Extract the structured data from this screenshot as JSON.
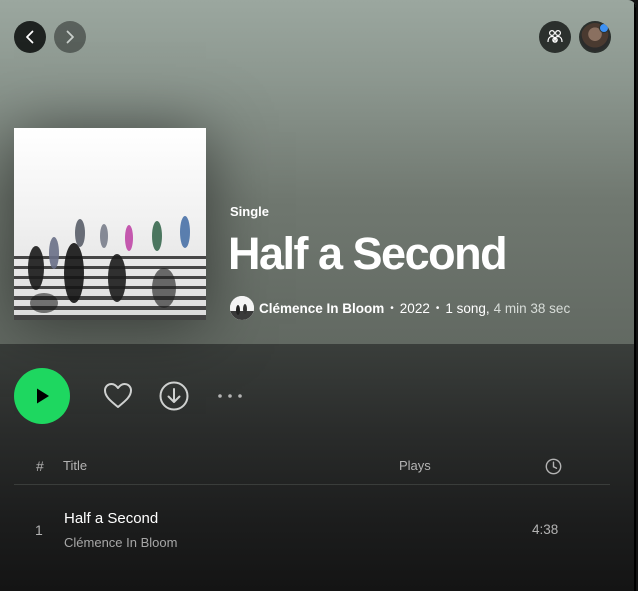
{
  "album": {
    "type": "Single",
    "title": "Half a Second",
    "artist": "Clémence In Bloom",
    "year": "2022",
    "song_count": "1 song,",
    "duration": "4 min 38 sec",
    "separator": "•"
  },
  "table": {
    "num_header": "#",
    "title_header": "Title",
    "plays_header": "Plays"
  },
  "tracks": [
    {
      "number": "1",
      "title": "Half a Second",
      "artist": "Clémence In Bloom",
      "duration": "4:38"
    }
  ],
  "colors": {
    "accent": "#1ed760",
    "background": "#121212",
    "header_tint": "#8c978f",
    "notification_dot": "#3d91f4"
  },
  "icons": {
    "back": "chevron-left-icon",
    "forward": "chevron-right-icon",
    "friends": "friend-activity-icon",
    "play": "play-icon",
    "like": "heart-icon",
    "download": "download-icon",
    "more": "more-options-icon",
    "duration": "clock-icon"
  }
}
